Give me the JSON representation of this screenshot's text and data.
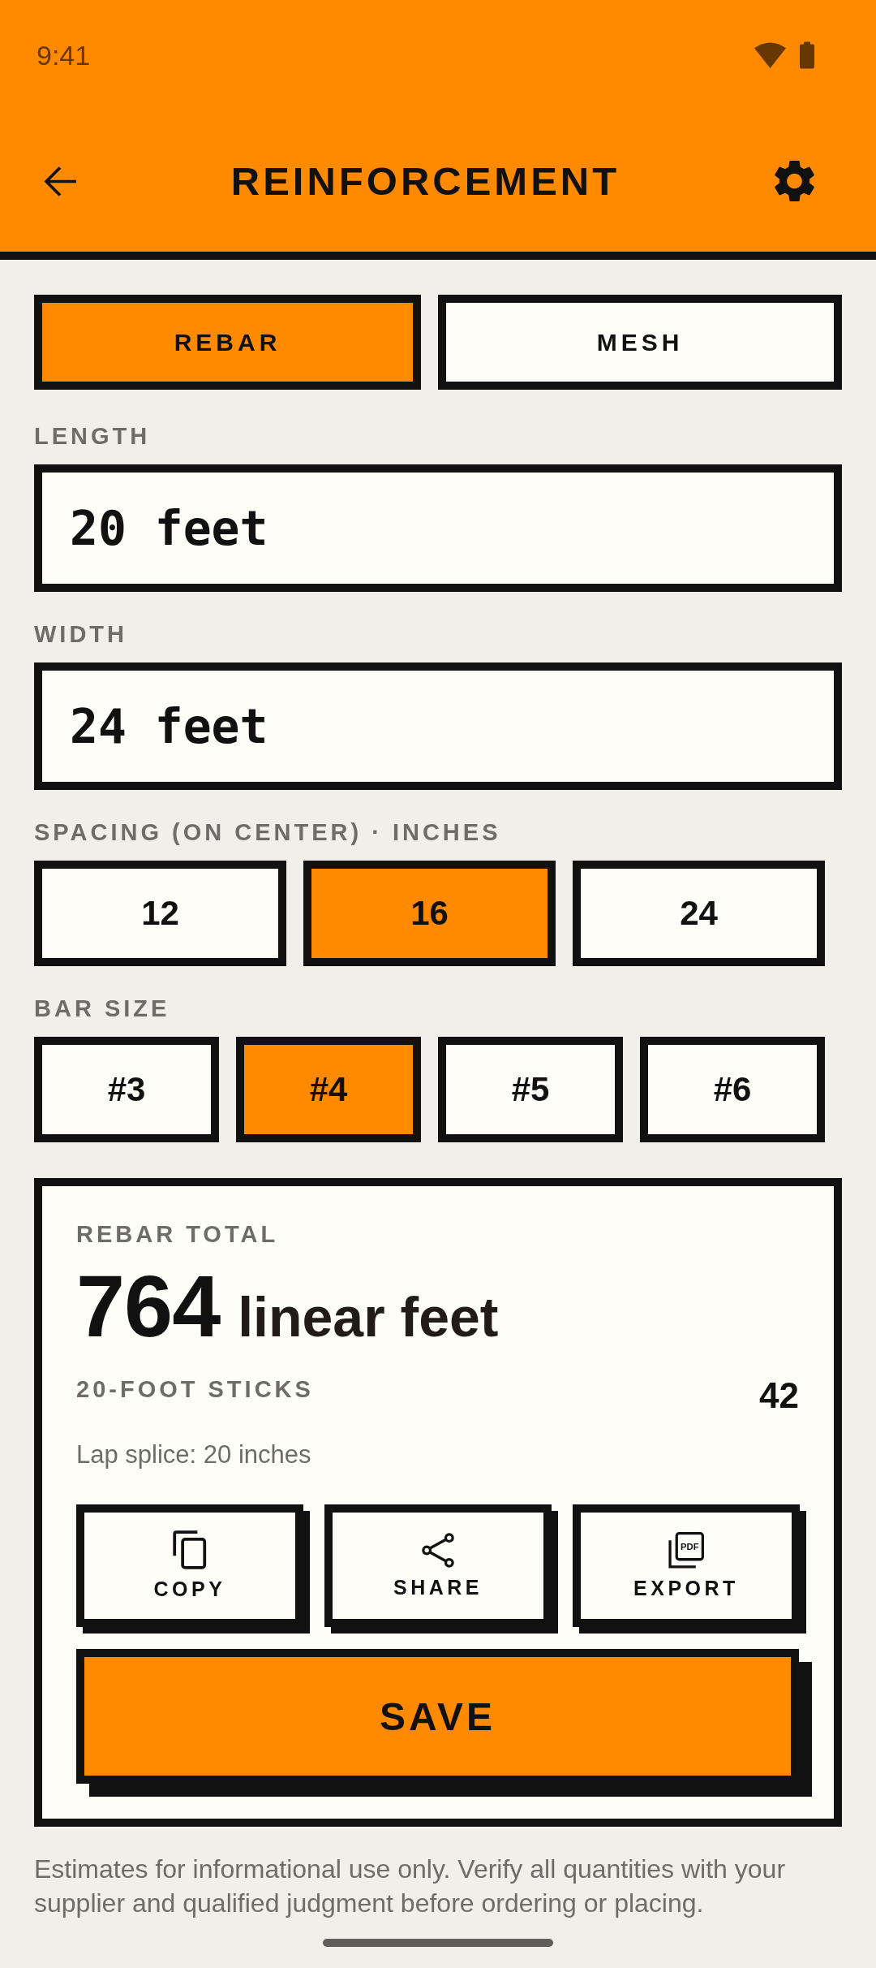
{
  "status_bar": {
    "time": "9:41"
  },
  "app_bar": {
    "title": "REINFORCEMENT"
  },
  "mode_tabs": [
    {
      "label": "REBAR",
      "selected": true
    },
    {
      "label": "MESH",
      "selected": false
    }
  ],
  "fields": [
    {
      "label": "LENGTH",
      "value": "20 feet"
    },
    {
      "label": "WIDTH",
      "value": "24 feet"
    }
  ],
  "spacing": {
    "label": "SPACING (ON CENTER) · INCHES",
    "options": [
      {
        "label": "12",
        "selected": false
      },
      {
        "label": "16",
        "selected": true
      },
      {
        "label": "24",
        "selected": false
      }
    ]
  },
  "bar_size": {
    "label": "BAR SIZE",
    "options": [
      {
        "label": "#3",
        "selected": false
      },
      {
        "label": "#4",
        "selected": true
      },
      {
        "label": "#5",
        "selected": false
      },
      {
        "label": "#6",
        "selected": false
      }
    ]
  },
  "result": {
    "label": "REBAR TOTAL",
    "total": "764",
    "unit": "linear feet",
    "sticks_label": "20-FOOT STICKS",
    "sticks_value": "42",
    "note": "Lap splice: 20 inches",
    "actions": [
      {
        "kind": "copy",
        "label": "COPY"
      },
      {
        "kind": "share",
        "label": "SHARE"
      },
      {
        "kind": "export",
        "label": "EXPORT",
        "icon_text": "PDF"
      }
    ],
    "save_label": "SAVE"
  },
  "disclaimer": "Estimates for informational use only. Verify all quantities with your supplier and qualified judgment before ordering or placing."
}
